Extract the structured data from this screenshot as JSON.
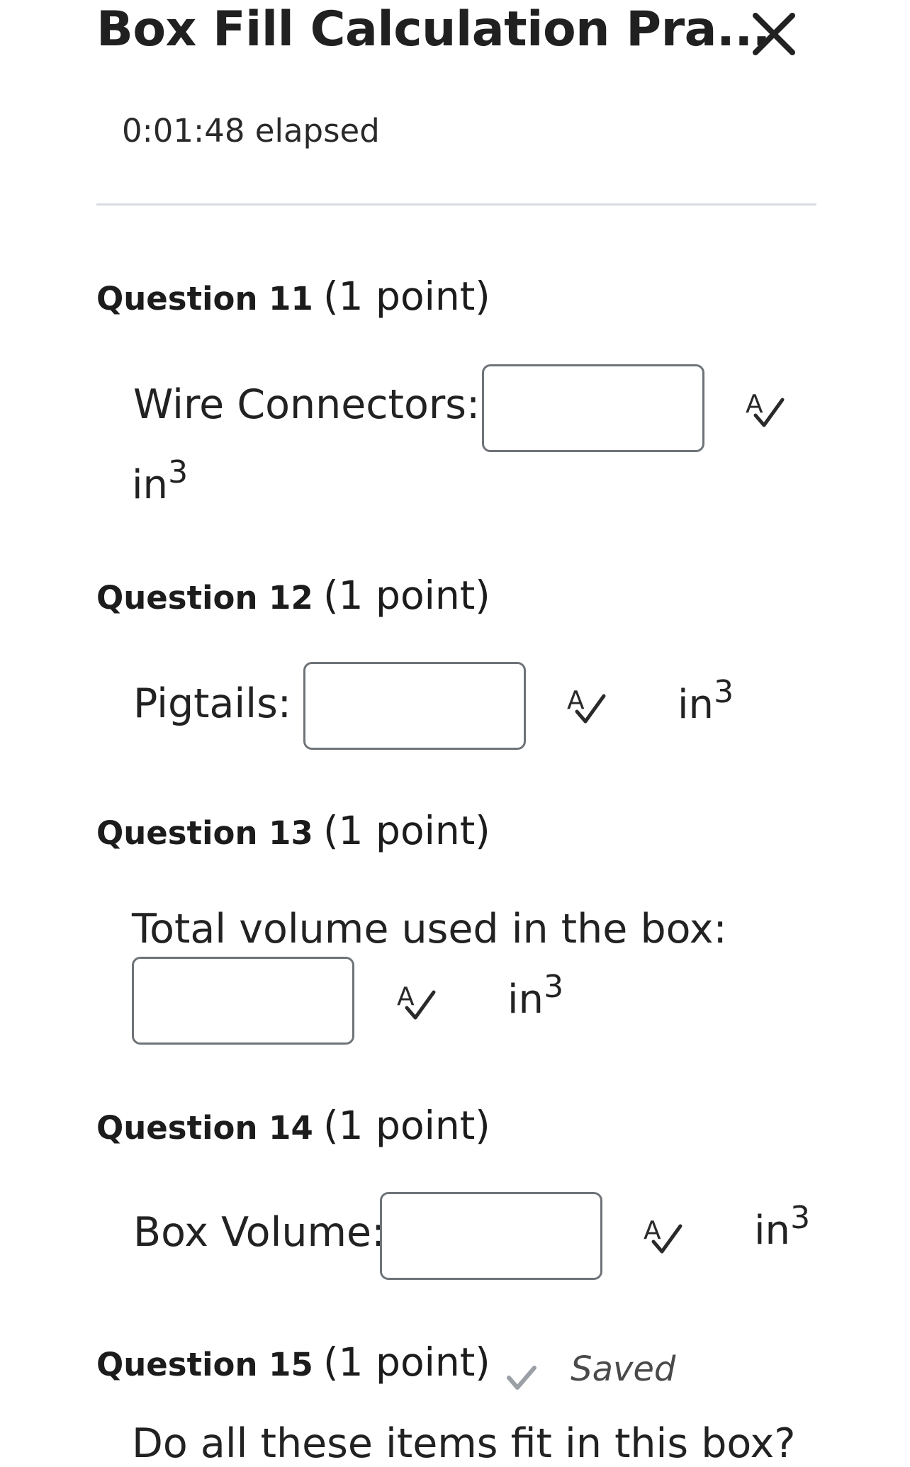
{
  "header": {
    "title": "Box Fill Calculation Pra...",
    "elapsed": "0:01:48 elapsed"
  },
  "questions": [
    {
      "number": "Question 11",
      "points": "(1 point)",
      "label": "Wire Connectors:",
      "unit": "in",
      "unit_exp": "3",
      "value": ""
    },
    {
      "number": "Question 12",
      "points": "(1 point)",
      "label": "Pigtails:",
      "unit": "in",
      "unit_exp": "3",
      "value": ""
    },
    {
      "number": "Question 13",
      "points": "(1 point)",
      "label": "Total volume used in the box:",
      "unit": "in",
      "unit_exp": "3",
      "value": ""
    },
    {
      "number": "Question 14",
      "points": "(1 point)",
      "label": "Box Volume:",
      "unit": "in",
      "unit_exp": "3",
      "value": ""
    },
    {
      "number": "Question 15",
      "points": "(1 point)",
      "status": "Saved",
      "prompt": "Do all these items fit in this box?"
    }
  ],
  "icons": {
    "close": "close-icon",
    "spellcheck": "spellcheck-icon",
    "saved": "checkmark-icon"
  },
  "colors": {
    "text": "#1f1f1f",
    "input_border": "#6e7378",
    "divider": "#d9dce0",
    "check": "#9aa0a6"
  }
}
